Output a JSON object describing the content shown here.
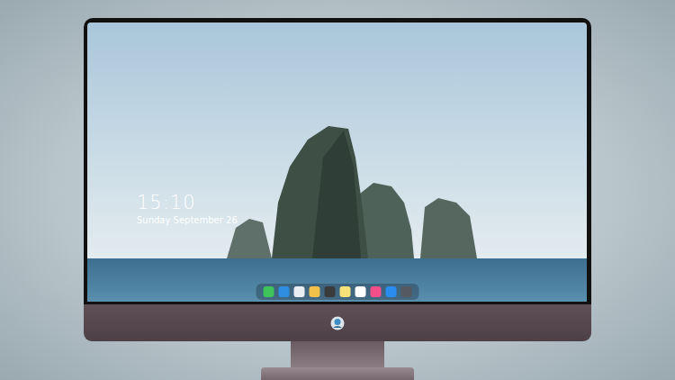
{
  "lock_screen": {
    "time": "15:10",
    "date": "Sunday September 26"
  }
}
